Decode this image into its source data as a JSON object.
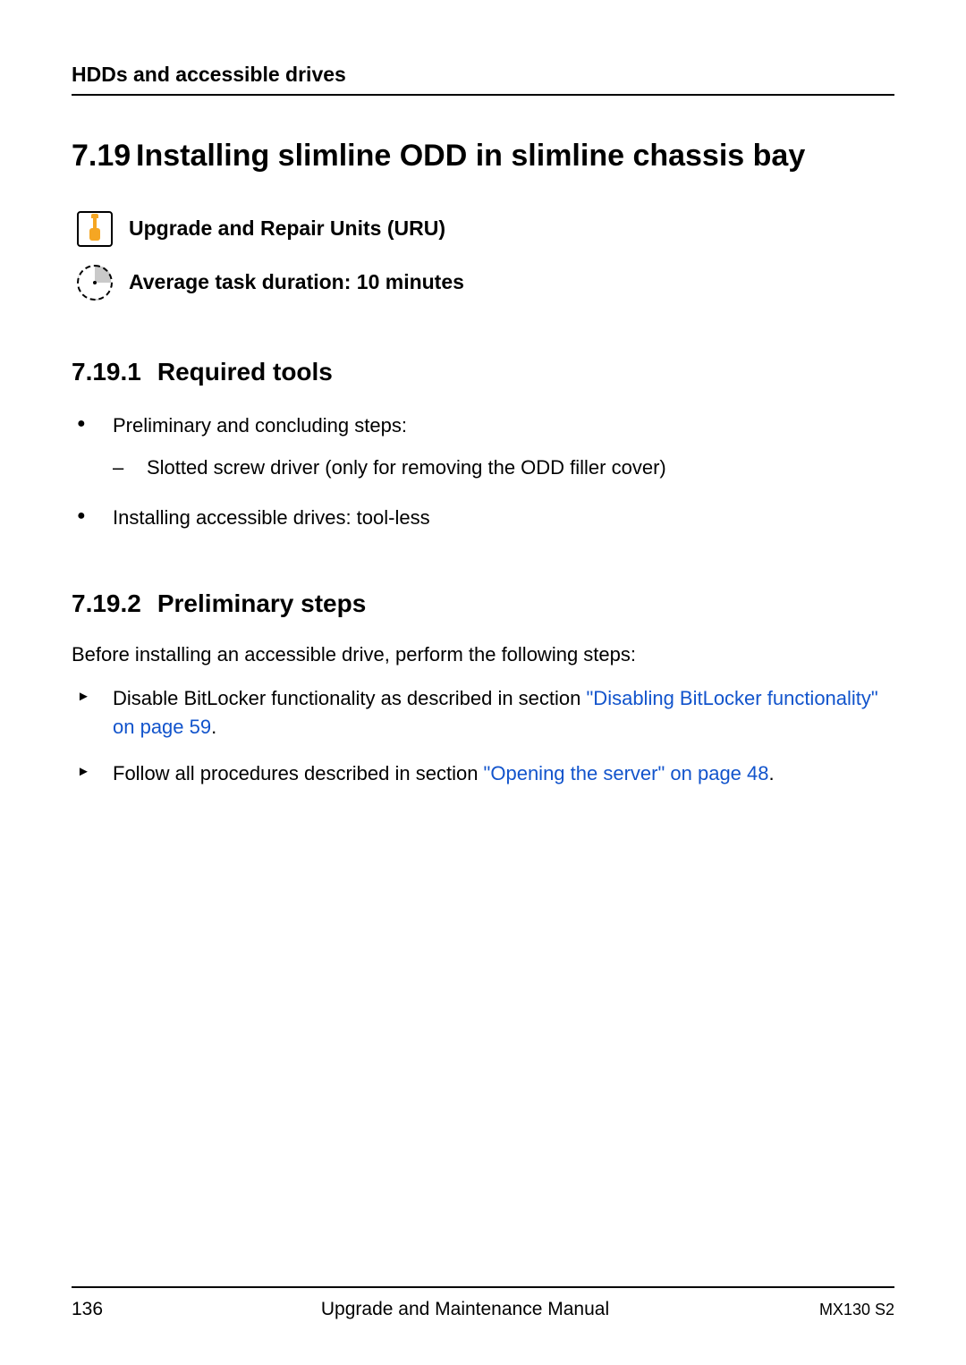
{
  "header": {
    "running_head": "HDDs and accessible drives"
  },
  "section": {
    "number": "7.19",
    "title": "Installing slimline ODD in slimline chassis bay",
    "info_uru": "Upgrade and Repair Units (URU)",
    "info_duration": "Average task duration: 10 minutes"
  },
  "subsec1": {
    "number": "7.19.1",
    "title": "Required tools",
    "bullet1": "Preliminary and concluding steps:",
    "bullet1_sub": "Slotted screw driver (only for removing the ODD filler cover)",
    "bullet2": "Installing accessible drives: tool-less"
  },
  "subsec2": {
    "number": "7.19.2",
    "title": "Preliminary steps",
    "intro": "Before installing an accessible drive, perform the following steps:",
    "step1_a": "Disable BitLocker functionality as described in section ",
    "step1_link": "\"Disabling BitLocker functionality\" on page 59",
    "step1_b": ".",
    "step2_a": "Follow all procedures described in section ",
    "step2_link": "\"Opening the server\" on page 48",
    "step2_b": "."
  },
  "footer": {
    "page": "136",
    "center": "Upgrade and Maintenance Manual",
    "right": "MX130 S2"
  }
}
